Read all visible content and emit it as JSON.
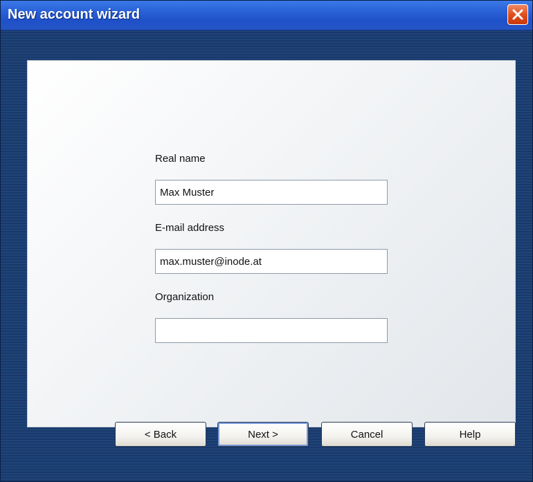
{
  "window": {
    "title": "New account wizard"
  },
  "form": {
    "real_name": {
      "label": "Real name",
      "value": "Max Muster",
      "placeholder": ""
    },
    "email": {
      "label": "E-mail address",
      "value": "max.muster@inode.at",
      "placeholder": ""
    },
    "organization": {
      "label": "Organization",
      "value": "",
      "placeholder": ""
    }
  },
  "buttons": {
    "back": "< Back",
    "next": "Next >",
    "cancel": "Cancel",
    "help": "Help"
  },
  "icons": {
    "close": "close-icon"
  },
  "colors": {
    "titlebar": "#2b63d8",
    "close_button": "#e0501d",
    "background": "#1f4478"
  }
}
